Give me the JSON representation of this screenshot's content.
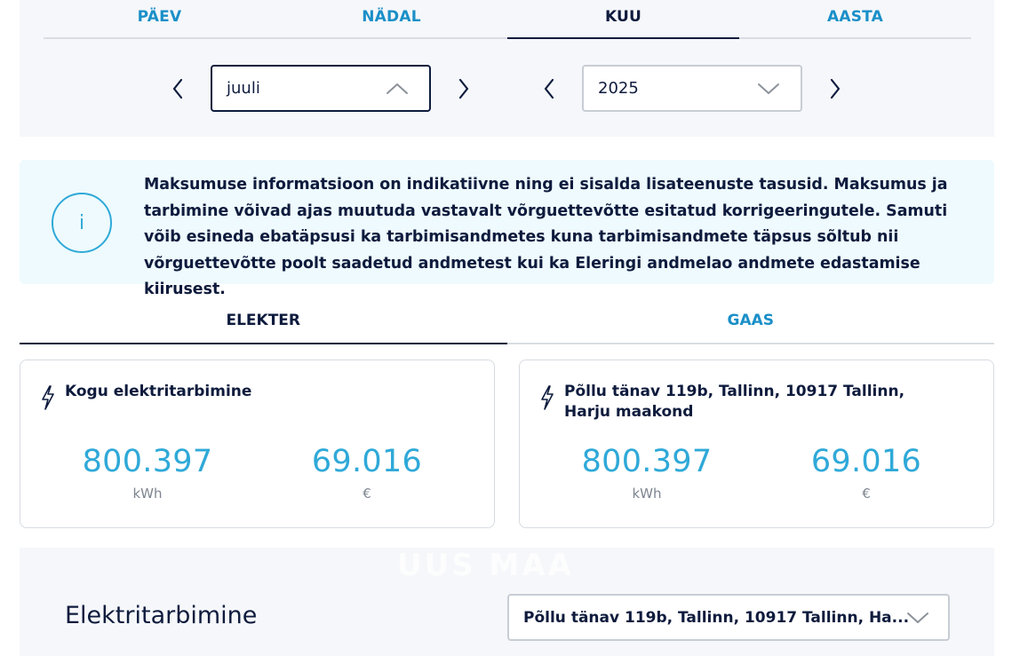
{
  "period_tabs": [
    {
      "label": "PÄEV",
      "active": false
    },
    {
      "label": "NÄDAL",
      "active": false
    },
    {
      "label": "KUU",
      "active": true
    },
    {
      "label": "AASTA",
      "active": false
    }
  ],
  "month_select": {
    "value": "juuli",
    "expanded": true
  },
  "year_select": {
    "value": "2025",
    "expanded": false
  },
  "info": {
    "icon": "info-icon",
    "icon_glyph": "i",
    "text": "Maksumuse informatsioon on indikatiivne ning ei sisalda lisateenuste tasusid. Maksumus ja tarbimine võivad ajas muutuda vastavalt võrguettevõtte esitatud korrigeeringutele. Samuti võib esineda ebatäpsusi ka tarbimisandmetes kuna tarbimisandmete täpsus sõltub nii võrguettevõtte poolt saadetud andmetest kui ka Eleringi andmelao andmete edastamise kiirusest."
  },
  "energy_tabs": [
    {
      "label": "ELEKTER",
      "active": true
    },
    {
      "label": "GAAS",
      "active": false
    }
  ],
  "cards": [
    {
      "icon": "lightning-bolt-icon",
      "title": "Kogu elektritarbimine",
      "consumption": "800.397",
      "consumption_unit": "kWh",
      "cost": "69.016",
      "cost_unit": "€"
    },
    {
      "icon": "lightning-bolt-icon",
      "title": "Põllu tänav 119b, Tallinn, 10917 Tallinn, Harju maakond",
      "consumption": "800.397",
      "consumption_unit": "kWh",
      "cost": "69.016",
      "cost_unit": "€"
    }
  ],
  "consumption_section": {
    "watermark": "UUS MAA",
    "title": "Elektritarbimine",
    "address_select": "Põllu tänav 119b, Tallinn, 10917 Tallinn, Ha..."
  },
  "colors": {
    "accent": "#1a8fc8",
    "value": "#2fa9d8",
    "dark": "#0e1b3d",
    "panel": "#f5f7fa",
    "info_bg": "#eefafd"
  }
}
